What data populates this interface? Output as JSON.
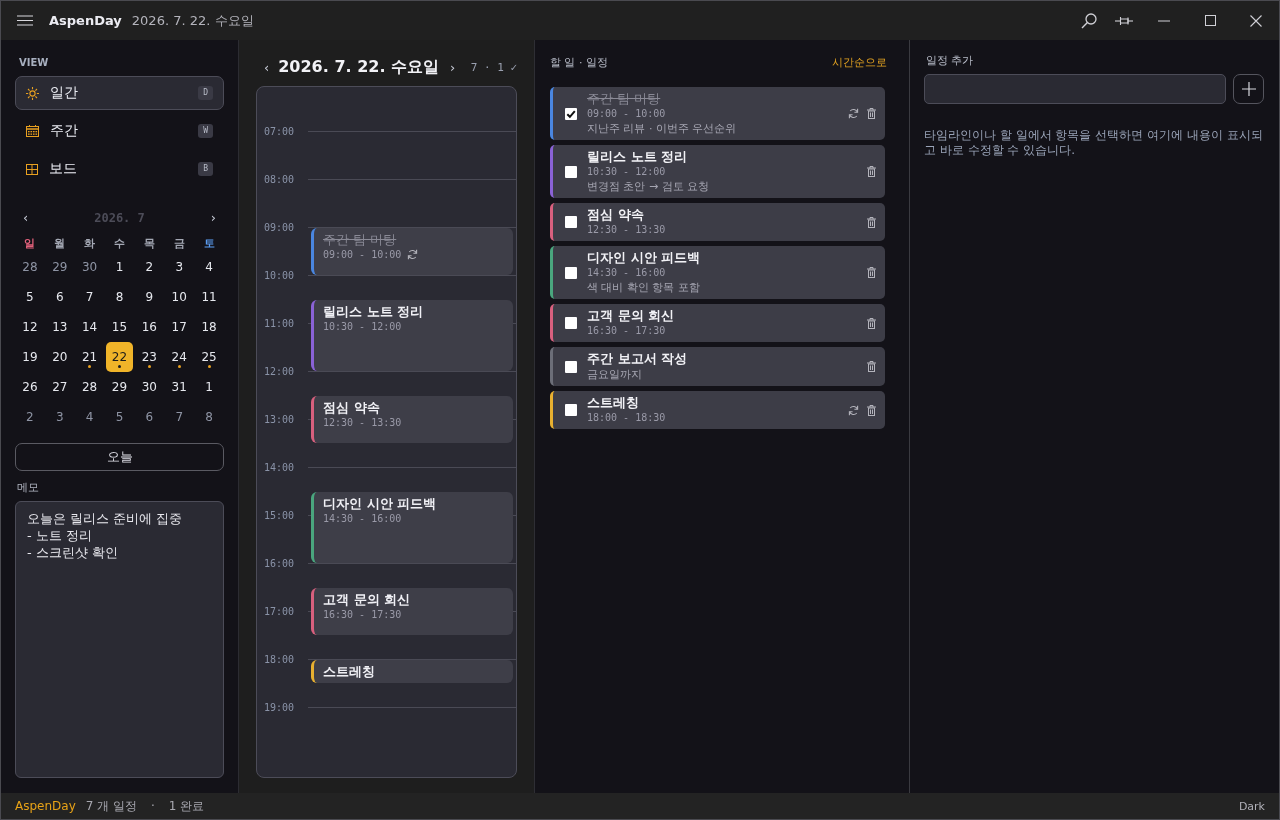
{
  "window": {
    "app_name": "AspenDay",
    "date": "2026. 7. 22. 수요일"
  },
  "sidebar": {
    "section_label": "VIEW",
    "views": [
      {
        "label": "일간",
        "shortcut": "D",
        "selected": true
      },
      {
        "label": "주간",
        "shortcut": "W",
        "selected": false
      },
      {
        "label": "보드",
        "shortcut": "B",
        "selected": false
      }
    ],
    "mini_calendar": {
      "prev": "‹",
      "month": "2026. 7",
      "next": "›",
      "weekdays": [
        {
          "label": "일",
          "color": "#e0607a"
        },
        {
          "label": "월",
          "color": "#a4a8b4"
        },
        {
          "label": "화",
          "color": "#a4a8b4"
        },
        {
          "label": "수",
          "color": "#a4a8b4"
        },
        {
          "label": "목",
          "color": "#a4a8b4"
        },
        {
          "label": "금",
          "color": "#a4a8b4"
        },
        {
          "label": "토",
          "color": "#5b9cf0"
        }
      ],
      "weeks": [
        [
          {
            "label": "28",
            "dimmed": true,
            "selected": false,
            "dot": false
          },
          {
            "label": "29",
            "dimmed": true,
            "selected": false,
            "dot": false
          },
          {
            "label": "30",
            "dimmed": true,
            "selected": false,
            "dot": false
          },
          {
            "label": "1",
            "dimmed": false,
            "selected": false,
            "dot": false
          },
          {
            "label": "2",
            "dimmed": false,
            "selected": false,
            "dot": false
          },
          {
            "label": "3",
            "dimmed": false,
            "selected": false,
            "dot": false
          },
          {
            "label": "4",
            "dimmed": false,
            "selected": false,
            "dot": false
          }
        ],
        [
          {
            "label": "5",
            "dimmed": false,
            "selected": false,
            "dot": false
          },
          {
            "label": "6",
            "dimmed": false,
            "selected": false,
            "dot": false
          },
          {
            "label": "7",
            "dimmed": false,
            "selected": false,
            "dot": false
          },
          {
            "label": "8",
            "dimmed": false,
            "selected": false,
            "dot": false
          },
          {
            "label": "9",
            "dimmed": false,
            "selected": false,
            "dot": false
          },
          {
            "label": "10",
            "dimmed": false,
            "selected": false,
            "dot": false
          },
          {
            "label": "11",
            "dimmed": false,
            "selected": false,
            "dot": false
          }
        ],
        [
          {
            "label": "12",
            "dimmed": false,
            "selected": false,
            "dot": false
          },
          {
            "label": "13",
            "dimmed": false,
            "selected": false,
            "dot": false
          },
          {
            "label": "14",
            "dimmed": false,
            "selected": false,
            "dot": false
          },
          {
            "label": "15",
            "dimmed": false,
            "selected": false,
            "dot": false
          },
          {
            "label": "16",
            "dimmed": false,
            "selected": false,
            "dot": false
          },
          {
            "label": "17",
            "dimmed": false,
            "selected": false,
            "dot": false
          },
          {
            "label": "18",
            "dimmed": false,
            "selected": false,
            "dot": false
          }
        ],
        [
          {
            "label": "19",
            "dimmed": false,
            "selected": false,
            "dot": false
          },
          {
            "label": "20",
            "dimmed": false,
            "selected": false,
            "dot": false
          },
          {
            "label": "21",
            "dimmed": false,
            "selected": false,
            "dot": true
          },
          {
            "label": "22",
            "dimmed": false,
            "selected": true,
            "dot": true
          },
          {
            "label": "23",
            "dimmed": false,
            "selected": false,
            "dot": true
          },
          {
            "label": "24",
            "dimmed": false,
            "selected": false,
            "dot": true
          },
          {
            "label": "25",
            "dimmed": false,
            "selected": false,
            "dot": true
          }
        ],
        [
          {
            "label": "26",
            "dimmed": false,
            "selected": false,
            "dot": false
          },
          {
            "label": "27",
            "dimmed": false,
            "selected": false,
            "dot": false
          },
          {
            "label": "28",
            "dimmed": false,
            "selected": false,
            "dot": false
          },
          {
            "label": "29",
            "dimmed": false,
            "selected": false,
            "dot": false
          },
          {
            "label": "30",
            "dimmed": false,
            "selected": false,
            "dot": false
          },
          {
            "label": "31",
            "dimmed": false,
            "selected": false,
            "dot": false
          },
          {
            "label": "1",
            "dimmed": false,
            "selected": false,
            "dot": false
          }
        ],
        [
          {
            "label": "2",
            "dimmed": true,
            "selected": false,
            "dot": false
          },
          {
            "label": "3",
            "dimmed": true,
            "selected": false,
            "dot": false
          },
          {
            "label": "4",
            "dimmed": true,
            "selected": false,
            "dot": false
          },
          {
            "label": "5",
            "dimmed": true,
            "selected": false,
            "dot": false
          },
          {
            "label": "6",
            "dimmed": true,
            "selected": false,
            "dot": false
          },
          {
            "label": "7",
            "dimmed": true,
            "selected": false,
            "dot": false
          },
          {
            "label": "8",
            "dimmed": true,
            "selected": false,
            "dot": false
          }
        ]
      ]
    },
    "today_button": "오늘",
    "memo": {
      "label": "메모",
      "text": "오늘은 릴리스 준비에 집중\n- 노트 정리\n- 스크린샷 확인"
    }
  },
  "timeline": {
    "prev": "‹",
    "date": "2026. 7. 22. 수요일",
    "next": "›",
    "summary": "7 · 1 ✓",
    "hours": [
      {
        "label": "07:00"
      },
      {
        "label": "08:00"
      },
      {
        "label": "09:00",
        "events": [
          {
            "title": "주간 팀 미팅",
            "time": "09:00 - 10:00",
            "half_past": false,
            "done": true,
            "repeat": true,
            "color": "#4a86e0"
          }
        ]
      },
      {
        "label": "10:00",
        "events": [
          {
            "title": "릴리스 노트 정리",
            "time": "10:30 - 12:00",
            "half_past": true,
            "done": false,
            "repeat": false,
            "color": "#8a62d6"
          }
        ]
      },
      {
        "label": "11:00"
      },
      {
        "label": "12:00",
        "events": [
          {
            "title": "점심 약속",
            "time": "12:30 - 13:30",
            "half_past": true,
            "done": false,
            "repeat": false,
            "color": "#d8607e"
          }
        ]
      },
      {
        "label": "13:00"
      },
      {
        "label": "14:00",
        "events": [
          {
            "title": "디자인 시안 피드백",
            "time": "14:30 - 16:00",
            "half_past": true,
            "done": false,
            "repeat": false,
            "color": "#4aa67e"
          }
        ]
      },
      {
        "label": "15:00"
      },
      {
        "label": "16:00",
        "events": [
          {
            "title": "고객 문의 회신",
            "time": "16:30 - 17:30",
            "half_past": true,
            "done": false,
            "repeat": false,
            "color": "#d8607e"
          }
        ]
      },
      {
        "label": "17:00"
      },
      {
        "label": "18:00",
        "events": [
          {
            "title": "스트레칭",
            "half_past": false,
            "done": false,
            "repeat": false,
            "color": "#e8b030"
          }
        ]
      },
      {
        "label": "19:00"
      }
    ]
  },
  "tasks": {
    "title": "할 일 · 일정",
    "sort_link": "시간순으로",
    "items": [
      {
        "title": "주간 팀 미팅",
        "time": "09:00 - 10:00",
        "note": "지난주 리뷰 · 이번주 우선순위",
        "done": true,
        "repeat": true,
        "color": "#4a86e0"
      },
      {
        "title": "릴리스 노트 정리",
        "time": "10:30 - 12:00",
        "note": "변경점 초안 → 검토 요청",
        "done": false,
        "repeat": false,
        "color": "#8a62d6"
      },
      {
        "title": "점심 약속",
        "time": "12:30 - 13:30",
        "done": false,
        "repeat": false,
        "color": "#d8607e"
      },
      {
        "title": "디자인 시안 피드백",
        "time": "14:30 - 16:00",
        "note": "색 대비 확인 항목 포함",
        "done": false,
        "repeat": false,
        "color": "#4aa67e"
      },
      {
        "title": "고객 문의 회신",
        "time": "16:30 - 17:30",
        "done": false,
        "repeat": false,
        "color": "#d8607e"
      },
      {
        "title": "주간 보고서 작성",
        "note": "금요일까지",
        "done": false,
        "repeat": false,
        "color": "#6c6e78"
      },
      {
        "title": "스트레칭",
        "time": "18:00 - 18:30",
        "done": false,
        "repeat": true,
        "color": "#e8b030"
      }
    ]
  },
  "detail": {
    "label": "일정 추가",
    "hint": "타임라인이나 할 일에서 항목을 선택하면 여기에 내용이 표시되고 바로 수정할 수 있습니다."
  },
  "status_bar": {
    "app_name": "AspenDay",
    "event_count": "7 개 일정",
    "separator": "·",
    "done_count": "1 완료",
    "theme": "Dark"
  }
}
